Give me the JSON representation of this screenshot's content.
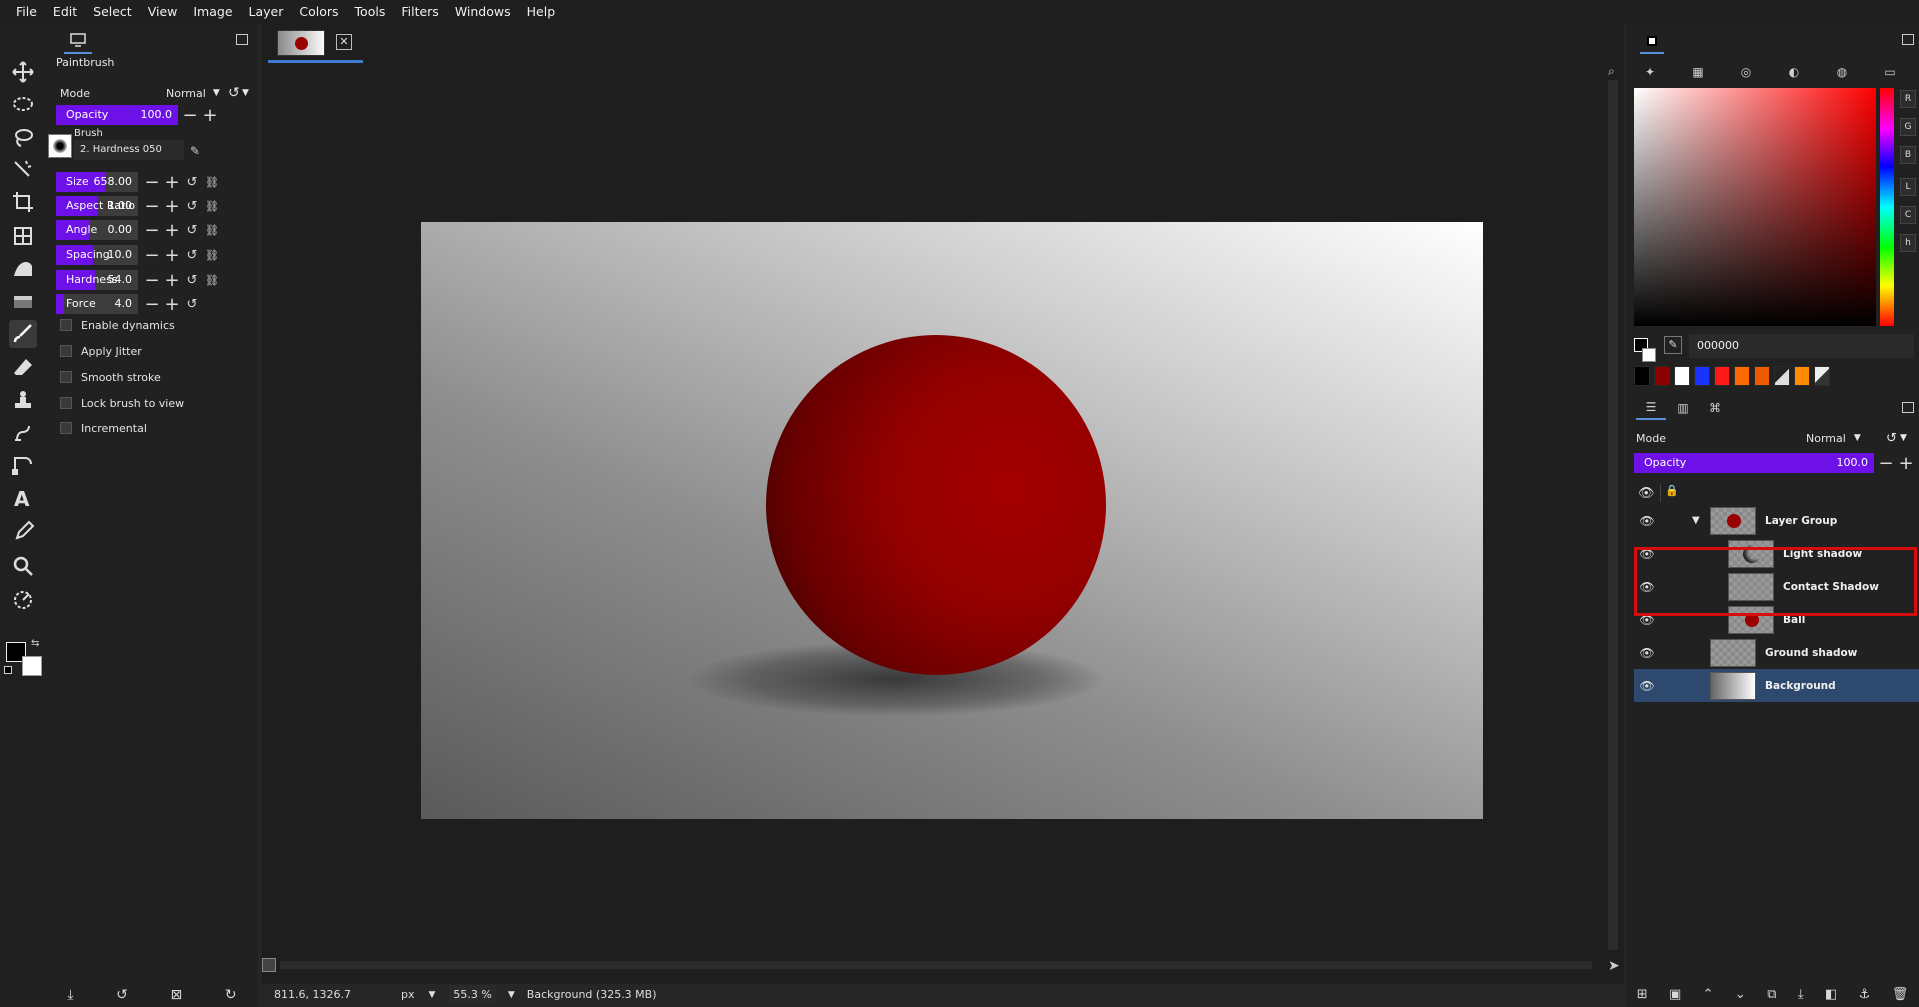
{
  "menubar": [
    "File",
    "Edit",
    "Select",
    "View",
    "Image",
    "Layer",
    "Colors",
    "Tools",
    "Filters",
    "Windows",
    "Help"
  ],
  "tools": [
    "move-icon",
    "ellipse-select-icon",
    "lasso-icon",
    "fuzzy-select-icon",
    "crop-icon",
    "transform-icon",
    "warp-icon",
    "gradient-icon",
    "paintbrush-icon",
    "eraser-icon",
    "clone-icon",
    "smudge-icon",
    "paths-icon",
    "text-icon",
    "color-picker-icon",
    "zoom-icon",
    "unified-icon"
  ],
  "tool_options": {
    "title": "Paintbrush",
    "mode_label": "Mode",
    "mode_value": "Normal",
    "opacity": {
      "label": "Opacity",
      "value": "100.0",
      "fraction": 1.0
    },
    "brush_label": "Brush",
    "brush_name": "2. Hardness 050",
    "size": {
      "label": "Size",
      "value": "658.00",
      "fraction": 0.6
    },
    "aspect_ratio": {
      "label": "Aspect Ratio",
      "value": "1.00",
      "fraction": 0.5
    },
    "angle": {
      "label": "Angle",
      "value": "0.00",
      "fraction": 0.4
    },
    "spacing": {
      "label": "Spacing",
      "value": "10.0",
      "fraction": 0.45
    },
    "hardness": {
      "label": "Hardness",
      "value": "54.0",
      "fraction": 0.47
    },
    "force": {
      "label": "Force",
      "value": "4.0",
      "fraction": 0.1
    },
    "checkboxes": [
      "Enable dynamics",
      "Apply Jitter",
      "Smooth stroke",
      "Lock brush to view",
      "Incremental"
    ]
  },
  "status": {
    "coords": "811.6, 1326.7",
    "unit": "px",
    "zoom": "55.3 %",
    "info": "Background (325.3 MB)"
  },
  "colors": {
    "hex": "000000",
    "channels": [
      "R",
      "G",
      "B",
      "L",
      "C",
      "h"
    ],
    "palette": [
      "#000000",
      "#8b0000",
      "#ffffff",
      "#1a33ff",
      "#ff1a1a",
      "#ff6a00",
      "#ff6a00",
      "#333333",
      "#ff8c00",
      "#dddddd"
    ]
  },
  "layers_panel": {
    "mode_label": "Mode",
    "mode_value": "Normal",
    "opacity": {
      "label": "Opacity",
      "value": "100.0",
      "fraction": 1.0
    },
    "layers": [
      {
        "name": "Layer Group",
        "indent": 0,
        "group": true
      },
      {
        "name": "Light shadow",
        "indent": 1
      },
      {
        "name": "Contact Shadow",
        "indent": 1
      },
      {
        "name": "Ball",
        "indent": 1
      },
      {
        "name": "Ground shadow",
        "indent": 0
      },
      {
        "name": "Background",
        "indent": 0,
        "selected": true
      }
    ]
  },
  "accent": "#6d11e8",
  "highlight_color": "#d50d0d"
}
